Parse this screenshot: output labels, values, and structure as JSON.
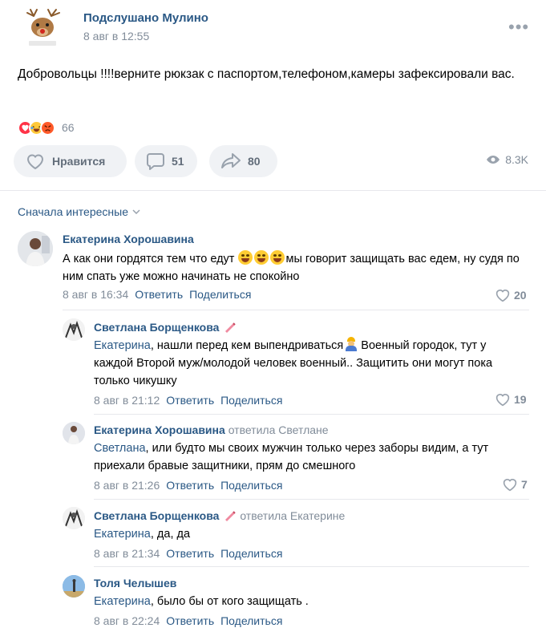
{
  "post": {
    "group_name": "Подслушано Мулино",
    "date": "8 авг в 12:55",
    "text": "Добровольцы !!!!верните рюкзак с паспортом,телефоном,камеры зафексировали вас.",
    "reactions": {
      "icons": [
        "heart-reaction-icon",
        "laughing-reaction-icon",
        "angry-reaction-icon"
      ],
      "count": "66"
    },
    "actions": {
      "like_label": "Нравится",
      "comments_count": "51",
      "shares_count": "80",
      "views_count": "8.3K"
    }
  },
  "comments_section": {
    "sort_label": "Сначала интересные"
  },
  "comments": [
    {
      "author": "Екатерина Хорошавина",
      "text_before": "А как они гордятся тем что едут ",
      "text_after": "мы говорит защищать вас едем, ну судя по ним спать уже можно начинать не спокойно",
      "date": "8 авг в 16:34",
      "reply": "Ответить",
      "share": "Поделиться",
      "likes": "20"
    },
    {
      "author": "Светлана Борщенкова",
      "mention": "Екатерина",
      "text_before": ", нашли перед кем выпендриваться",
      "text_after": " Военный городок, тут у каждой Второй муж/молодой человек военный.. Защитить они могут пока только чикушку",
      "date": "8 авг в 21:12",
      "reply": "Ответить",
      "share": "Поделиться",
      "likes": "19"
    },
    {
      "author": "Екатерина Хорошавина",
      "reply_to": "ответила Светлане",
      "mention": "Светлана",
      "text": ", или будто мы своих мужчин только через заборы видим, а тут приехали бравые защитники, прям до смешного",
      "date": "8 авг в 21:26",
      "reply": "Ответить",
      "share": "Поделиться",
      "likes": "7"
    },
    {
      "author": "Светлана Борщенкова",
      "reply_to": "ответила Екатерине",
      "mention": "Екатерина",
      "text": ", да, да",
      "date": "8 авг в 21:34",
      "reply": "Ответить",
      "share": "Поделиться"
    },
    {
      "author": "Толя Челышев",
      "mention": "Екатерина",
      "text": ", было бы от кого защищать .",
      "date": "8 авг в 22:24",
      "reply": "Ответить",
      "share": "Поделиться"
    }
  ],
  "colors": {
    "link": "#2a5885",
    "muted": "#818c99",
    "button_bg": "#f0f2f5",
    "divider": "#e7e8ec"
  }
}
